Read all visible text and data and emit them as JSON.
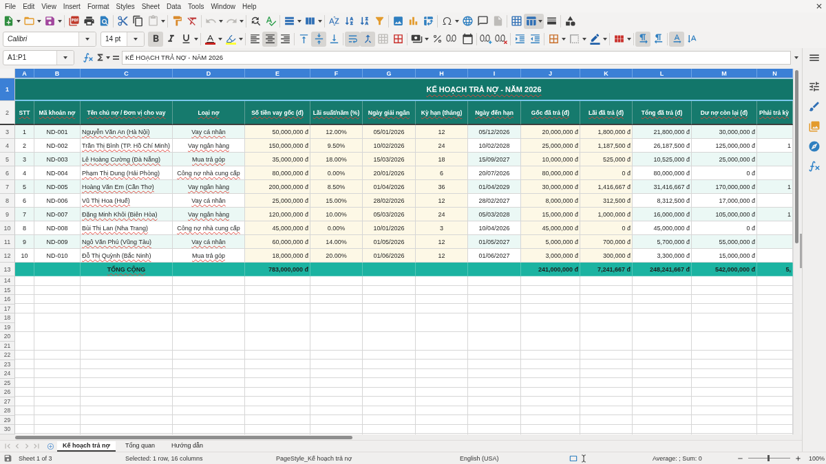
{
  "menu": [
    "File",
    "Edit",
    "View",
    "Insert",
    "Format",
    "Styles",
    "Sheet",
    "Data",
    "Tools",
    "Window",
    "Help"
  ],
  "standard_toolbar": {
    "paste_disabled": true,
    "undo_disabled": true,
    "redo_disabled": true,
    "headers_footers_disabled": true,
    "freeze_on": true
  },
  "formatting_toolbar": {
    "font_name": "Calibri",
    "font_size": "14 pt",
    "bold": true,
    "italic": false,
    "underline": false,
    "align_left": false,
    "align_center": true,
    "align_right": false,
    "align_top": false,
    "align_middle": true,
    "align_bottom": false,
    "wrap_text": true,
    "merge_and_center": true,
    "merge_cells_disabled": true,
    "left_to_right": true,
    "right_to_left": false,
    "text_horizontal": true,
    "text_vertical": false
  },
  "formula_bar": {
    "name_box": "A1:P1",
    "content": "KẾ HOẠCH TRẢ NỢ - NĂM 2026"
  },
  "sheet": {
    "column_headers": [
      {
        "label": "A",
        "selected": true
      },
      {
        "label": "B",
        "selected": true
      },
      {
        "label": "C",
        "selected": true
      },
      {
        "label": "D",
        "selected": true
      },
      {
        "label": "E",
        "selected": true
      },
      {
        "label": "F",
        "selected": true
      },
      {
        "label": "G",
        "selected": true
      },
      {
        "label": "H",
        "selected": true
      },
      {
        "label": "I",
        "selected": true
      },
      {
        "label": "J",
        "selected": true
      },
      {
        "label": "K",
        "selected": true
      },
      {
        "label": "L",
        "selected": true
      },
      {
        "label": "M",
        "selected": true
      },
      {
        "label": "N",
        "selected": true
      }
    ],
    "title_row": {
      "row_header": {
        "label": "1",
        "selected": true
      },
      "text": "KẾ HOẠCH TRẢ NỢ - NĂM 2026",
      "spell_marked": true
    },
    "heading_row": {
      "row_header": {
        "label": "2",
        "selected": false
      },
      "spell_marked": true
    },
    "columns": [
      {
        "heading": "STT",
        "input": false,
        "spell_marked": false,
        "total_filled": false
      },
      {
        "heading": "Mã khoản nợ",
        "input": false,
        "spell_marked": false,
        "total_filled": false
      },
      {
        "heading": "Tên chủ nợ / Đơn vị cho vay",
        "input": false,
        "spell_marked": true,
        "total_filled": true
      },
      {
        "heading": "Loại nợ",
        "input": false,
        "spell_marked": true,
        "total_filled": false
      },
      {
        "heading": "Số tiền vay gốc (đ)",
        "input": true,
        "spell_marked": false,
        "total_filled": true
      },
      {
        "heading": "Lãi suất/năm (%)",
        "input": true,
        "spell_marked": false,
        "total_filled": false
      },
      {
        "heading": "Ngày giải ngân",
        "input": true,
        "spell_marked": false,
        "total_filled": false
      },
      {
        "heading": "Kỳ hạn (tháng)",
        "input": true,
        "spell_marked": false,
        "total_filled": false
      },
      {
        "heading": "Ngày đến hạn",
        "input": false,
        "spell_marked": false,
        "total_filled": false
      },
      {
        "heading": "Gốc đã trả (đ)",
        "input": true,
        "spell_marked": false,
        "total_filled": true
      },
      {
        "heading": "Lãi đã trả (đ)",
        "input": true,
        "spell_marked": false,
        "total_filled": true
      },
      {
        "heading": "Tổng đã trả (đ)",
        "input": false,
        "spell_marked": false,
        "total_filled": true
      },
      {
        "heading": "Dư nợ còn lại (đ)",
        "input": false,
        "spell_marked": false,
        "total_filled": true
      },
      {
        "heading": "Phải trả kỳ",
        "input": false,
        "spell_marked": false,
        "total_filled": true
      }
    ],
    "rows": [
      {
        "row_header": {
          "label": "3",
          "selected": false
        },
        "cells": [
          "1",
          "ND-001",
          "Nguyễn Văn An (Hà Nội)",
          "Vay cá nhân",
          "50,000,000 đ",
          "12.00%",
          "05/01/2026",
          "12",
          "05/12/2026",
          "20,000,000 đ",
          "1,800,000 đ",
          "21,800,000 đ",
          "30,000,000 đ"
        ]
      },
      {
        "row_header": {
          "label": "4",
          "selected": false
        },
        "cells": [
          "2",
          "ND-002",
          "Trần Thị Bình (TP. Hồ Chí Minh)",
          "Vay ngân hàng",
          "150,000,000 đ",
          "9.50%",
          "10/02/2026",
          "24",
          "10/02/2028",
          "25,000,000 đ",
          "1,187,500 đ",
          "26,187,500 đ",
          "125,000,000 đ",
          "1"
        ]
      },
      {
        "row_header": {
          "label": "5",
          "selected": false
        },
        "cells": [
          "3",
          "ND-003",
          "Lê Hoàng Cường (Đà Nẵng)",
          "Mua trả góp",
          "35,000,000 đ",
          "18.00%",
          "15/03/2026",
          "18",
          "15/09/2027",
          "10,000,000 đ",
          "525,000 đ",
          "10,525,000 đ",
          "25,000,000 đ"
        ]
      },
      {
        "row_header": {
          "label": "6",
          "selected": false
        },
        "cells": [
          "4",
          "ND-004",
          "Phạm Thị Dung (Hải Phòng)",
          "Công nợ nhà cung cấp",
          "80,000,000 đ",
          "0.00%",
          "20/01/2026",
          "6",
          "20/07/2026",
          "80,000,000 đ",
          "0 đ",
          "80,000,000 đ",
          "0 đ"
        ]
      },
      {
        "row_header": {
          "label": "7",
          "selected": false
        },
        "cells": [
          "5",
          "ND-005",
          "Hoàng Văn Em (Cần Thơ)",
          "Vay ngân hàng",
          "200,000,000 đ",
          "8.50%",
          "01/04/2026",
          "36",
          "01/04/2029",
          "30,000,000 đ",
          "1,416,667 đ",
          "31,416,667 đ",
          "170,000,000 đ",
          "1"
        ]
      },
      {
        "row_header": {
          "label": "8",
          "selected": false
        },
        "cells": [
          "6",
          "ND-006",
          "Vũ Thị Hoa (Huế)",
          "Vay cá nhân",
          "25,000,000 đ",
          "15.00%",
          "28/02/2026",
          "12",
          "28/02/2027",
          "8,000,000 đ",
          "312,500 đ",
          "8,312,500 đ",
          "17,000,000 đ"
        ]
      },
      {
        "row_header": {
          "label": "9",
          "selected": false
        },
        "cells": [
          "7",
          "ND-007",
          "Đặng Minh Khôi (Biên Hòa)",
          "Vay ngân hàng",
          "120,000,000 đ",
          "10.00%",
          "05/03/2026",
          "24",
          "05/03/2028",
          "15,000,000 đ",
          "1,000,000 đ",
          "16,000,000 đ",
          "105,000,000 đ",
          "1"
        ]
      },
      {
        "row_header": {
          "label": "10",
          "selected": false
        },
        "cells": [
          "8",
          "ND-008",
          "Bùi Thị Lan (Nha Trang)",
          "Công nợ nhà cung cấp",
          "45,000,000 đ",
          "0.00%",
          "10/01/2026",
          "3",
          "10/04/2026",
          "45,000,000 đ",
          "0 đ",
          "45,000,000 đ",
          "0 đ"
        ]
      },
      {
        "row_header": {
          "label": "11",
          "selected": false
        },
        "cells": [
          "9",
          "ND-009",
          "Ngô Văn Phú (Vũng Tàu)",
          "Vay cá nhân",
          "60,000,000 đ",
          "14.00%",
          "01/05/2026",
          "12",
          "01/05/2027",
          "5,000,000 đ",
          "700,000 đ",
          "5,700,000 đ",
          "55,000,000 đ"
        ]
      },
      {
        "row_header": {
          "label": "12",
          "selected": false
        },
        "cells": [
          "10",
          "ND-010",
          "Đỗ Thị Quỳnh (Bắc Ninh)",
          "Mua trả góp",
          "18,000,000 đ",
          "20.00%",
          "01/06/2026",
          "12",
          "01/06/2027",
          "3,000,000 đ",
          "300,000 đ",
          "3,300,000 đ",
          "15,000,000 đ"
        ]
      }
    ],
    "total_row": {
      "row_header": {
        "label": "13",
        "selected": false
      },
      "cells": [
        "TỔNG CỘNG",
        "783,000,000 đ",
        "241,000,000 đ",
        "7,241,667 đ",
        "248,241,667 đ",
        "542,000,000 đ",
        "5,"
      ]
    },
    "empty_rows": [
      {
        "label": "14",
        "selected": false
      },
      {
        "label": "15",
        "selected": false
      },
      {
        "label": "16",
        "selected": false
      },
      {
        "label": "17",
        "selected": false
      },
      {
        "label": "18",
        "selected": false
      },
      {
        "label": "19",
        "selected": false
      },
      {
        "label": "20",
        "selected": false
      },
      {
        "label": "21",
        "selected": false
      },
      {
        "label": "22",
        "selected": false
      },
      {
        "label": "23",
        "selected": false
      },
      {
        "label": "24",
        "selected": false
      },
      {
        "label": "25",
        "selected": false
      },
      {
        "label": "26",
        "selected": false
      },
      {
        "label": "27",
        "selected": false
      },
      {
        "label": "28",
        "selected": false
      },
      {
        "label": "29",
        "selected": false
      },
      {
        "label": "30",
        "selected": false
      }
    ]
  },
  "sheet_tabs": [
    {
      "label": "Kế hoạch trả nợ",
      "selected": true
    },
    {
      "label": "Tổng quan",
      "selected": false
    },
    {
      "label": "Hướng dẫn",
      "selected": false
    }
  ],
  "status_bar": {
    "sheet": "Sheet 1 of 3",
    "selection": "Selected: 1 row, 16 columns",
    "page_style": "PageStyle_Kế hoạch trả nợ",
    "language": "English (USA)",
    "sum": "Average: ; Sum: 0",
    "zoom": {
      "level": 0.47,
      "reading": "100%"
    }
  }
}
